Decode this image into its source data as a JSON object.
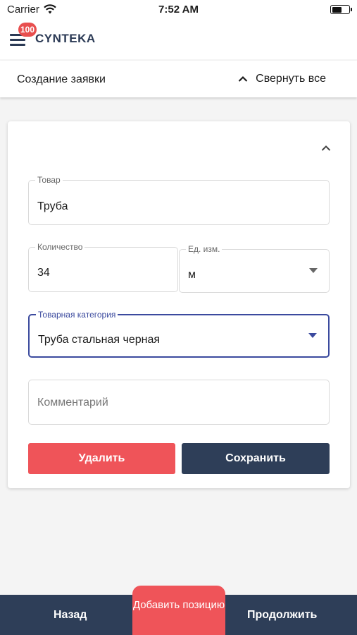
{
  "status_bar": {
    "carrier": "Carrier",
    "time": "7:52 AM",
    "battery_level": 0.6
  },
  "header": {
    "badge_count": "100",
    "logo": "CYNTEKA"
  },
  "subheader": {
    "title": "Создание заявки",
    "collapse_all": "Свернуть все"
  },
  "form": {
    "product": {
      "label": "Товар",
      "value": "Труба"
    },
    "quantity": {
      "label": "Количество",
      "value": "34"
    },
    "unit": {
      "label": "Ед. изм.",
      "value": "м"
    },
    "category": {
      "label": "Товарная категория",
      "value": "Труба стальная черная"
    },
    "comment": {
      "placeholder": "Комментарий"
    },
    "delete_label": "Удалить",
    "save_label": "Сохранить"
  },
  "bottom_bar": {
    "back_label": "Назад",
    "add_label": "Добавить позицию",
    "continue_label": "Продолжить"
  },
  "colors": {
    "brand_dark": "#2e3e58",
    "accent_red": "#ef5459",
    "focus_blue": "#3b4a9e"
  },
  "icons": [
    "wifi-icon",
    "battery-icon",
    "hamburger-menu-icon",
    "chevron-up-icon",
    "dropdown-arrow-icon"
  ]
}
